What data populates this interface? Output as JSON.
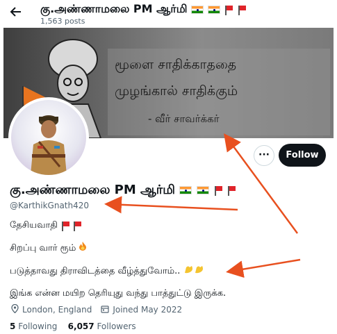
{
  "header": {
    "back_icon": "arrow-left-icon",
    "title": "கு.அண்ணாமலை PM ஆர்மி",
    "posts": "1,563 posts"
  },
  "banner": {
    "quote_line1": "மூளை சாதிக்காததை",
    "quote_line2": "முழங்கால் சாதிக்கும்",
    "quote_line3": "- வீர் சாவர்க்கர்"
  },
  "actions": {
    "more_icon": "ellipsis-icon",
    "more_label": "···",
    "follow_label": "Follow"
  },
  "profile": {
    "name": "கு.அண்ணாமலை PM ஆர்மி",
    "handle": "@KarthikGnath420",
    "bio_line1": "தேசியவாதி",
    "bio_line2": "சிறப்பு வார் ரூம்",
    "bio_line3": "படுத்தாவது திராவிடத்தை வீழ்த்துவோம்..",
    "bio_line4": "இங்க என்ன மயிற தெரியுது வந்து பாத்துட்டு இருக்க.",
    "location": "London, England",
    "joined": "Joined May 2022",
    "following_count": "5",
    "following_label": "Following",
    "followers_count": "6,057",
    "followers_label": "Followers"
  },
  "icons": {
    "india_flag": "india-flag-icon",
    "red_flag": "red-flag-icon",
    "fire": "fire-icon",
    "flexed_biceps": "flexed-biceps-icon",
    "location": "location-pin-icon",
    "calendar": "calendar-icon"
  },
  "colors": {
    "follow_button": "#0f1419",
    "secondary_text": "#536471",
    "annotation_arrow": "#e8501f"
  }
}
